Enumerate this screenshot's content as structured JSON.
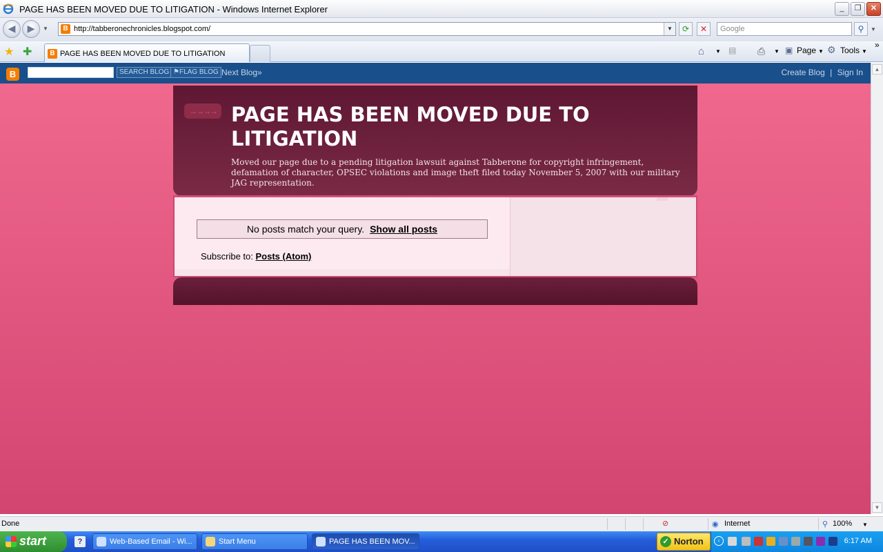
{
  "window": {
    "title": "PAGE HAS BEEN MOVED DUE TO LITIGATION - Windows Internet Explorer",
    "minimize": "_",
    "restore": "❐",
    "close": "✕"
  },
  "browser": {
    "url": "http://tabberonechronicles.blogspot.com/",
    "search_placeholder": "Google",
    "tab_title": "PAGE HAS BEEN MOVED DUE TO LITIGATION",
    "toolbar": {
      "page_label": "Page",
      "tools_label": "Tools"
    }
  },
  "blogger_nav": {
    "search_button": "SEARCH BLOG",
    "flag_button": "FLAG BLOG",
    "next_blog": "Next Blog»",
    "create_blog": "Create Blog",
    "separator": "|",
    "sign_in": "Sign In"
  },
  "blog": {
    "title": "PAGE HAS BEEN MOVED DUE TO LITIGATION",
    "description": "Moved our page due to a pending litigation lawsuit against Tabberone for copyright infringement, defamation of character, OPSEC violations and image theft filed today November 5, 2007 with our military JAG representation.",
    "no_posts_text": "No posts match your query.",
    "show_all_link": "Show all posts",
    "subscribe_label": "Subscribe to:",
    "subscribe_link": "Posts (Atom)"
  },
  "statusbar": {
    "status": "Done",
    "zone": "Internet",
    "zoom": "100%"
  },
  "taskbar": {
    "start": "start",
    "tasks": [
      "Web-Based Email - Wi...",
      "Start Menu",
      "PAGE HAS BEEN MOV..."
    ],
    "norton": "Norton",
    "clock": "6:17 AM"
  },
  "colors": {
    "page_bg_top": "#f0688e",
    "page_bg_bottom": "#d24571",
    "header_bg": "#5e1733",
    "nav_bg": "#194f8b",
    "blogger_orange": "#f57d00"
  }
}
